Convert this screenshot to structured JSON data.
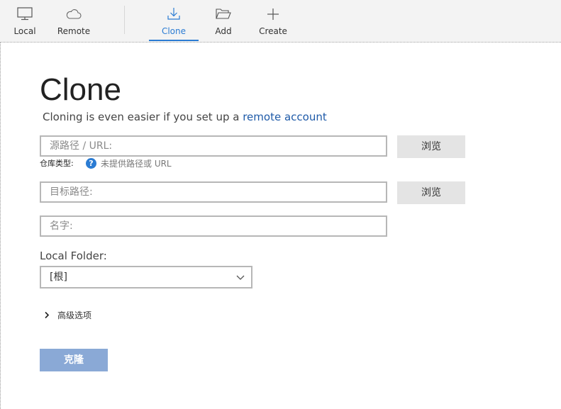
{
  "toolbar": {
    "items": [
      {
        "label": "Local",
        "icon": "monitor-icon"
      },
      {
        "label": "Remote",
        "icon": "cloud-icon"
      },
      {
        "label": "Clone",
        "icon": "download-icon",
        "active": true
      },
      {
        "label": "Add",
        "icon": "folder-open-icon"
      },
      {
        "label": "Create",
        "icon": "plus-icon"
      }
    ]
  },
  "colors": {
    "accent": "#2b7cd3",
    "clone_button": "#8aa9d6",
    "link": "#1e5aa8"
  },
  "main": {
    "title": "Clone",
    "subtitle_text": "Cloning is even easier if you set up a ",
    "subtitle_link": "remote account",
    "source": {
      "placeholder": "源路径 / URL:",
      "browse_label": "浏览"
    },
    "repo_type": {
      "label": "仓库类型:",
      "hint": "未提供路径或 URL",
      "help_glyph": "?"
    },
    "destination": {
      "placeholder": "目标路径:",
      "browse_label": "浏览"
    },
    "name": {
      "placeholder": "名字:"
    },
    "local_folder": {
      "label": "Local Folder:",
      "value": "[根]"
    },
    "advanced_label": "高级选项",
    "clone_button": "克隆"
  }
}
